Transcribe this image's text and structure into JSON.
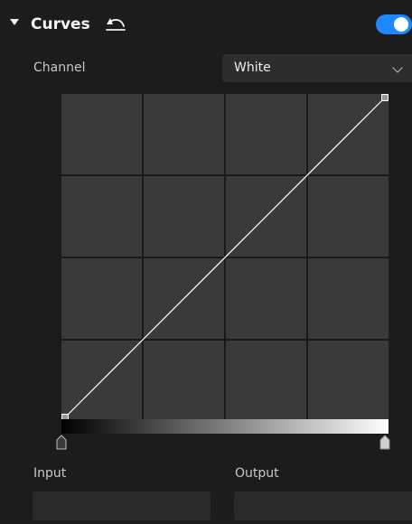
{
  "header": {
    "title": "Curves",
    "collapse_icon": "caret-down-icon",
    "reset_icon": "undo-icon",
    "toggle_on": true,
    "accent_color": "#1e88ff"
  },
  "channel": {
    "label": "Channel",
    "selected": "White",
    "icon": "chevron-down-icon"
  },
  "curve": {
    "grid_divisions": 4,
    "points": [
      {
        "input": 0,
        "output": 0
      },
      {
        "input": 255,
        "output": 255
      }
    ],
    "cell_color": "#3a3a3d",
    "line_color": "#ffffff"
  },
  "range": {
    "black_point": 0,
    "white_point": 255
  },
  "fields": {
    "input_label": "Input",
    "output_label": "Output",
    "input_value": "",
    "output_value": ""
  }
}
